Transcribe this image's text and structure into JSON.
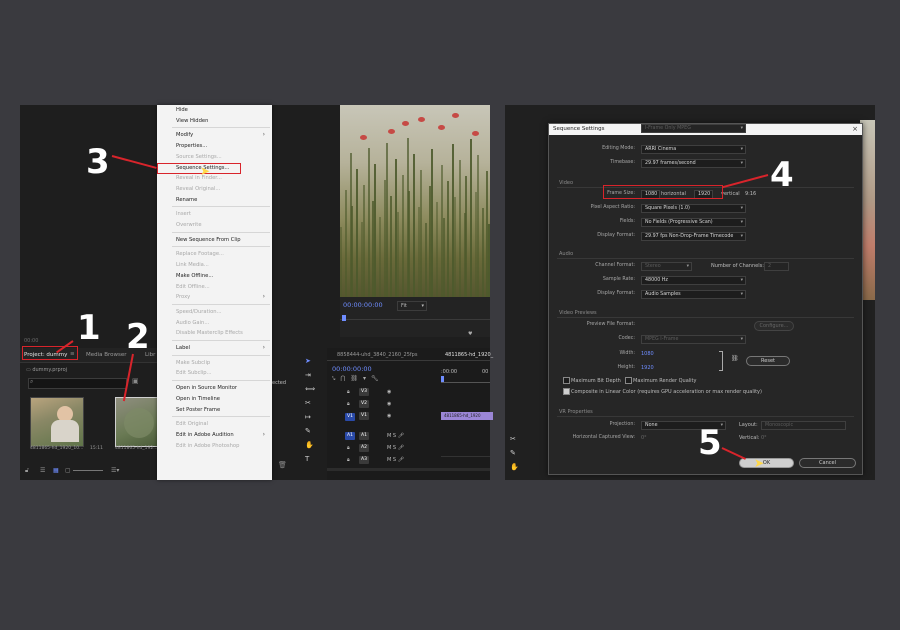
{
  "left": {
    "project_tab": "Project: dummy",
    "media_browser_tab": "Media Browser",
    "libraries_tab": "Libr",
    "project_file": "dummy.prproj",
    "thumb1_label": "4811865-hd_1920_10...",
    "thumb1_duration": "15:11",
    "thumb2_label": "4811865-hd_192...",
    "menu_items": [
      {
        "label": "Hide",
        "disabled": false
      },
      {
        "label": "View Hidden",
        "disabled": false
      },
      {
        "label": "Modify",
        "disabled": false,
        "sub": true
      },
      {
        "label": "Properties...",
        "disabled": false
      },
      {
        "label": "Source Settings...",
        "disabled": true
      },
      {
        "label": "Sequence Settings...",
        "disabled": false
      },
      {
        "label": "Reveal in Finder...",
        "disabled": true
      },
      {
        "label": "Reveal Original...",
        "disabled": true
      },
      {
        "label": "Rename",
        "disabled": false
      },
      {
        "label": "Insert",
        "disabled": true
      },
      {
        "label": "Overwrite",
        "disabled": true
      },
      {
        "label": "New Sequence From Clip",
        "disabled": false
      },
      {
        "label": "Replace Footage...",
        "disabled": true
      },
      {
        "label": "Link Media...",
        "disabled": true
      },
      {
        "label": "Make Offline...",
        "disabled": false
      },
      {
        "label": "Edit Offline...",
        "disabled": true
      },
      {
        "label": "Proxy",
        "disabled": true,
        "sub": true
      },
      {
        "label": "Speed/Duration...",
        "disabled": true
      },
      {
        "label": "Audio Gain...",
        "disabled": true
      },
      {
        "label": "Disable Masterclip Effects",
        "disabled": true
      },
      {
        "label": "Label",
        "disabled": false,
        "sub": true
      },
      {
        "label": "Make Subclip",
        "disabled": true
      },
      {
        "label": "Edit Subclip...",
        "disabled": true
      },
      {
        "label": "Open in Source Monitor",
        "disabled": false
      },
      {
        "label": "Open in Timeline",
        "disabled": false
      },
      {
        "label": "Set Poster Frame",
        "disabled": false
      },
      {
        "label": "Edit Original",
        "disabled": true
      },
      {
        "label": "Edit in Adobe Audition",
        "disabled": false,
        "sub": true
      },
      {
        "label": "Edit in Adobe Photoshop",
        "disabled": true
      }
    ],
    "monitor_timecode": "00:00:00:00",
    "fit_label": "Fit",
    "timeline_tab1": "8858444-uhd_3840_2160_25fps",
    "timeline_tab2": "4811865-hd_1920_",
    "timeline_timecode": "00:00:00:00",
    "ruler_start": ":00:00",
    "ruler_end": "00",
    "selected_label": "ected",
    "video_tracks": [
      "V3",
      "V2",
      "V1"
    ],
    "audio_tracks": [
      "A1",
      "A2",
      "A3"
    ],
    "track_v1_src": "V1",
    "track_a1_src": "A1",
    "clip_label": "4811865-hd_1920",
    "steps": [
      "1",
      "2",
      "3"
    ]
  },
  "dialog": {
    "title": "Sequence Settings",
    "close": "×",
    "editing_mode_label": "Editing Mode:",
    "editing_mode_value": "ARRI Cinema",
    "timebase_label": "Timebase:",
    "timebase_value": "29.97 frames/second",
    "video_section": "Video",
    "frame_size_label": "Frame Size:",
    "frame_width": "1080",
    "horizontal_label": "horizontal",
    "frame_height": "1920",
    "vertical_label": "vertical",
    "aspect_label": "9:16",
    "pixel_aspect_label": "Pixel Aspect Ratio:",
    "pixel_aspect_value": "Square Pixels (1.0)",
    "fields_label": "Fields:",
    "fields_value": "No Fields (Progressive Scan)",
    "display_format_label": "Display Format:",
    "display_format_value": "29.97 fps Non-Drop-Frame Timecode",
    "audio_section": "Audio",
    "channel_format_label": "Channel Format:",
    "channel_format_value": "Stereo",
    "num_channels_label": "Number of Channels:",
    "num_channels_value": "2",
    "sample_rate_label": "Sample Rate:",
    "sample_rate_value": "48000 Hz",
    "audio_display_format_label": "Display Format:",
    "audio_display_format_value": "Audio Samples",
    "previews_section": "Video Previews",
    "preview_format_label": "Preview File Format:",
    "preview_format_value": "I-Frame Only MPEG",
    "configure_label": "Configure...",
    "codec_label": "Codec:",
    "codec_value": "MPEG I-Frame",
    "width_label": "Width:",
    "width_value": "1080",
    "height_label": "Height:",
    "height_value": "1920",
    "reset_label": "Reset",
    "max_bit_depth": "Maximum Bit Depth",
    "max_render_quality": "Maximum Render Quality",
    "composite_linear": "Composite in Linear Color (requires GPU acceleration or max render quality)",
    "vr_section": "VR Properties",
    "projection_label": "Projection:",
    "projection_value": "None",
    "layout_label": "Layout:",
    "layout_value": "Monoscopic",
    "h_captured_label": "Horizontal Captured View:",
    "h_captured_value": "0°",
    "vertical_captured_label": "Vertical:",
    "vertical_captured_value": "0°",
    "ok_label": "OK",
    "cancel_label": "Cancel",
    "bg_clip_label": "4811865-hd_1920_1080_25fps.mp4",
    "steps": [
      "4",
      "5"
    ]
  },
  "colors": {
    "accent": "#6f8dff",
    "highlight": "#d8242b",
    "clip": "#9b86d6"
  }
}
